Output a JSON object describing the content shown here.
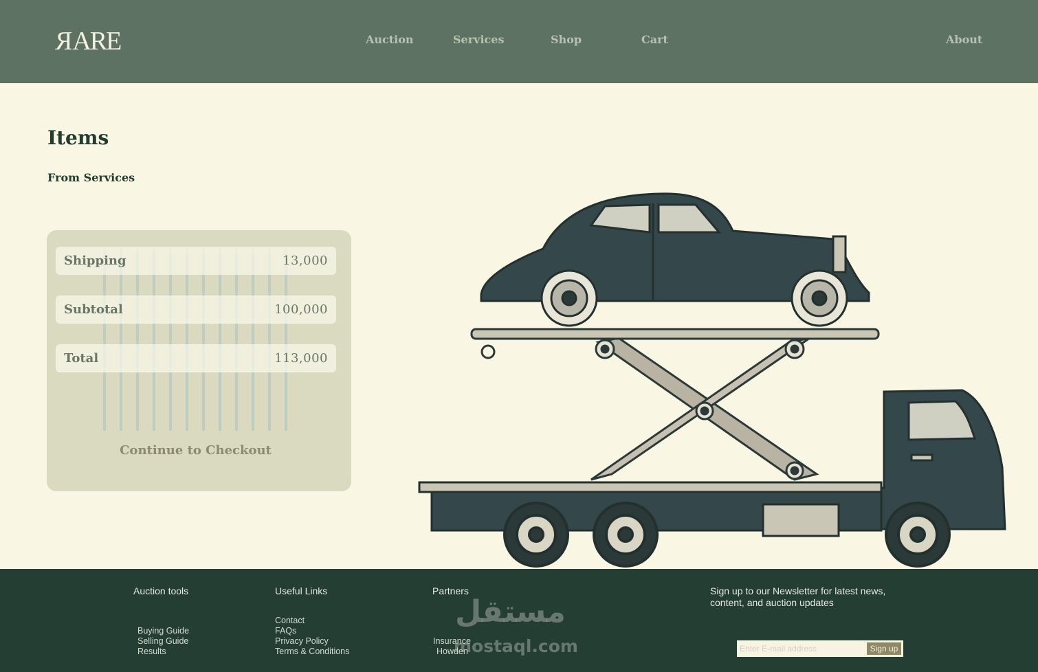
{
  "header": {
    "logo": "RARE",
    "nav": [
      "Auction",
      "Services",
      "Shop",
      "Cart",
      "About"
    ]
  },
  "main": {
    "title": "Items",
    "subtitle": "From Services",
    "summary": [
      {
        "label": "Shipping",
        "value": "13,000"
      },
      {
        "label": "Subtotal",
        "value": "100,000"
      },
      {
        "label": "Total",
        "value": "113,000"
      }
    ],
    "checkout_label": "Continue to Checkout"
  },
  "footer": {
    "columns": [
      {
        "heading": "Auction tools",
        "links": [
          "Buying Guide",
          "Selling Guide",
          "Results"
        ]
      },
      {
        "heading": "Useful Links",
        "links": [
          "Contact",
          "FAQs",
          "Privacy Policy",
          "Terms & Conditions"
        ]
      },
      {
        "heading": "Partners",
        "links": [
          "Insurance",
          "Howden"
        ]
      }
    ],
    "newsletter_text": "Sign up to our Newsletter for latest news, content, and auction updates",
    "email_placeholder": "Enter E-mail address",
    "signup_label": "Sign up",
    "watermark_arabic": "مستقل",
    "watermark_latin": "mostaql.com"
  },
  "colors": {
    "header_bg": "#5d7262",
    "page_bg": "#f9f6e4",
    "panel_bg": "#d9dac0",
    "footer_bg": "#243e33",
    "title_text": "#223d30"
  }
}
